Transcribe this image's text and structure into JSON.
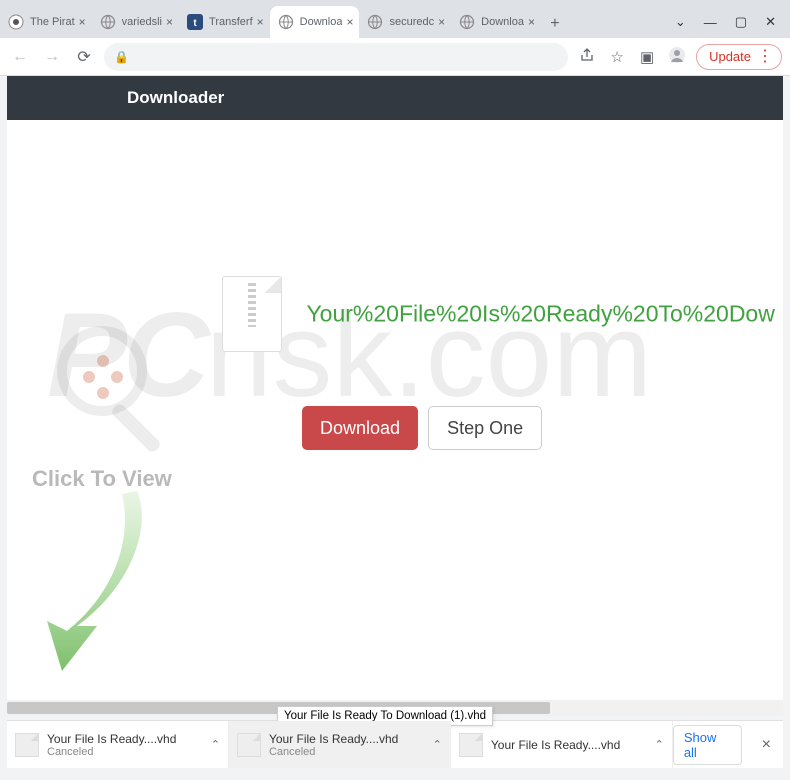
{
  "window": {
    "tabs": [
      {
        "title": "The Pirat"
      },
      {
        "title": "variedsli"
      },
      {
        "title": "Transferf"
      },
      {
        "title": "Downloa",
        "active": true
      },
      {
        "title": "securedc"
      },
      {
        "title": "Downloa"
      }
    ],
    "update_label": "Update"
  },
  "page": {
    "header_title": "Downloader",
    "ready_text": "Your%20File%20Is%20Ready%20To%20Dow",
    "download_button": "Download",
    "step_button": "Step One",
    "click_to_view": "Click To View",
    "watermark_main": "PC",
    "watermark_sub": "risk.com"
  },
  "downloads": {
    "items": [
      {
        "name": "Your File Is Ready....vhd",
        "status": "Canceled"
      },
      {
        "name": "Your File Is Ready....vhd",
        "status": "Canceled",
        "active": true
      },
      {
        "name": "Your File Is Ready....vhd",
        "status": ""
      }
    ],
    "tooltip": "Your File Is Ready To Download (1).vhd",
    "show_all": "Show all"
  }
}
